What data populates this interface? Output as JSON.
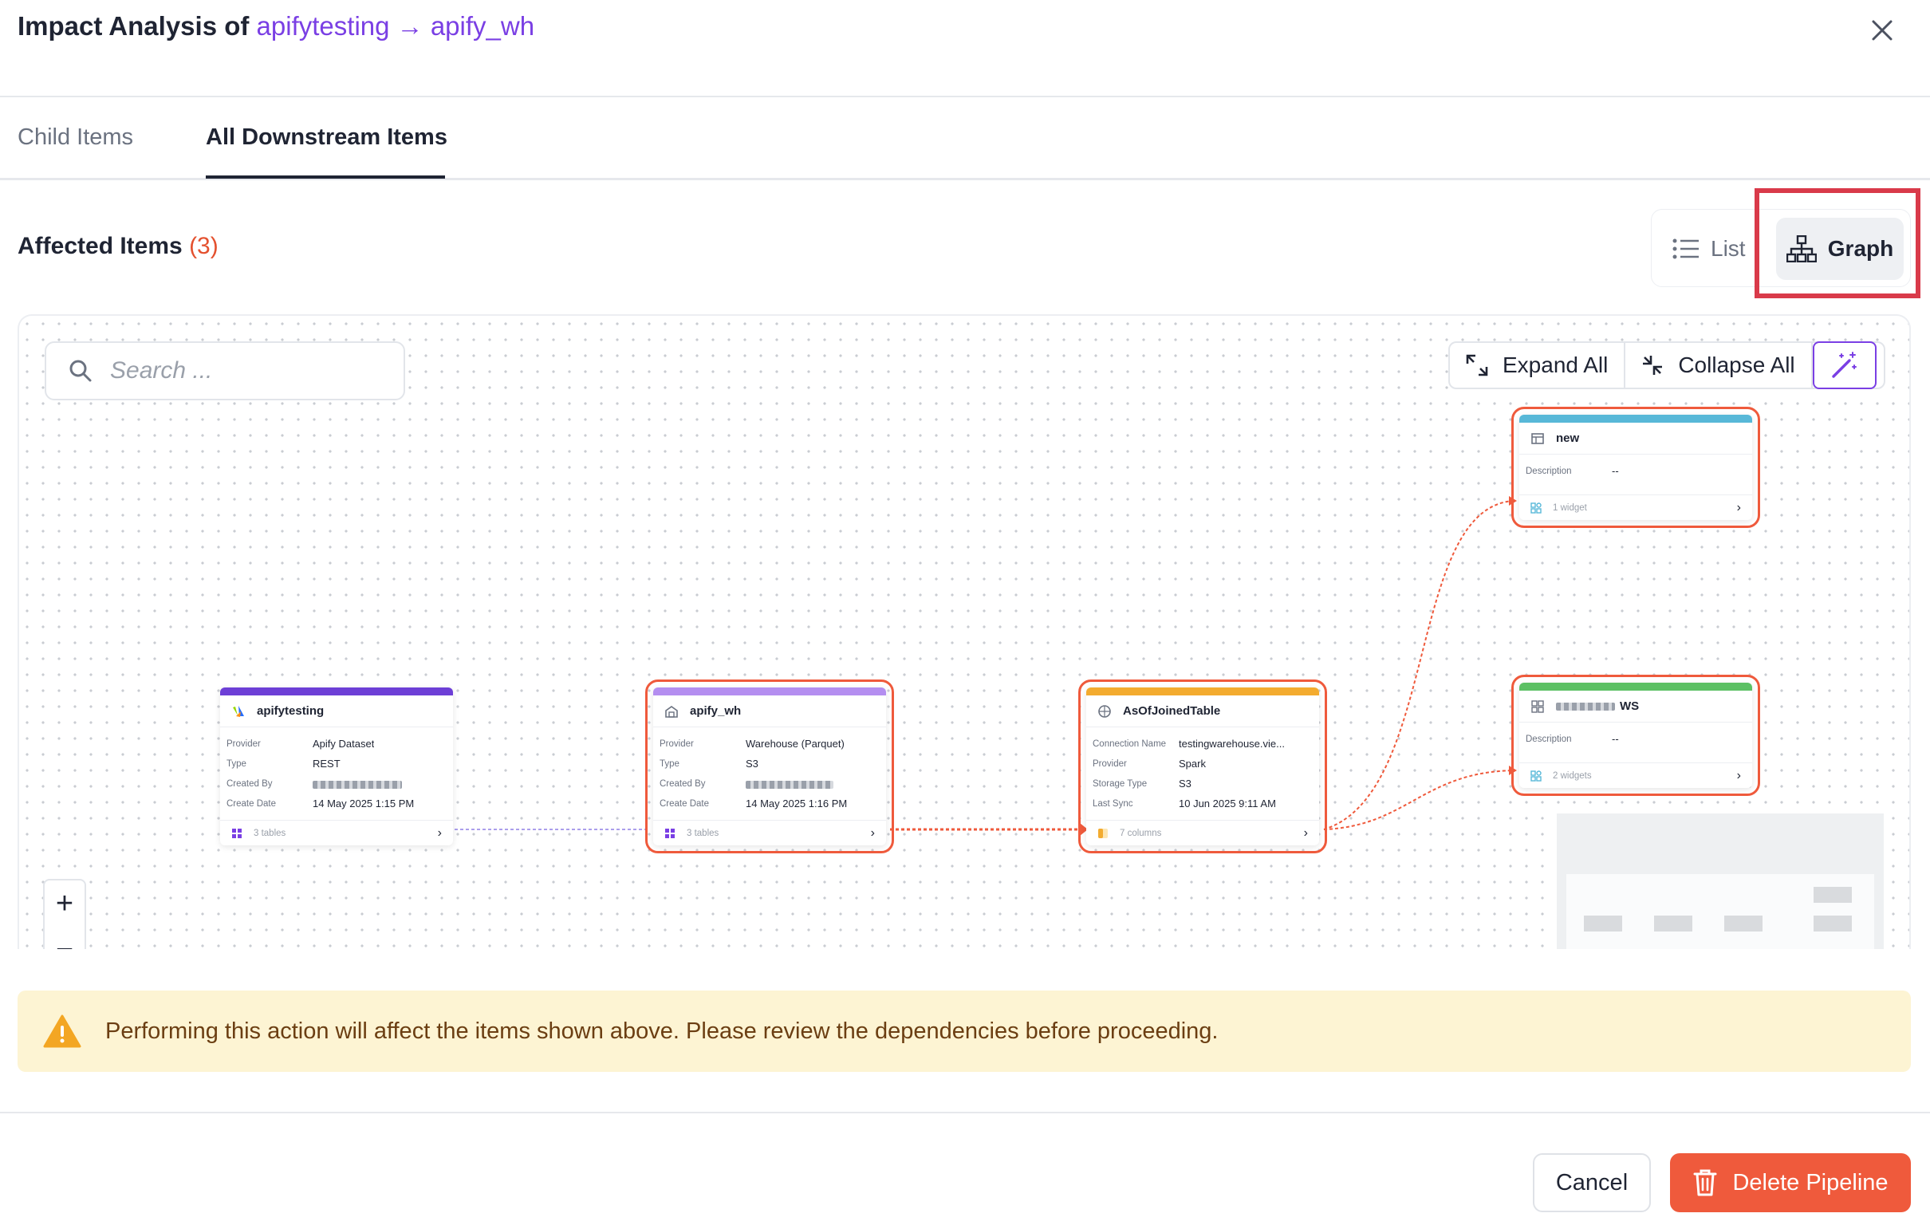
{
  "header": {
    "title_prefix": "Impact Analysis of",
    "title_source": "apifytesting",
    "title_arrow": "→",
    "title_target": "apify_wh"
  },
  "tabs": [
    {
      "label": "Child Items",
      "active": false
    },
    {
      "label": "All Downstream Items",
      "active": true
    }
  ],
  "affected": {
    "label": "Affected Items",
    "count": "(3)"
  },
  "view_toggle": {
    "list_label": "List",
    "graph_label": "Graph",
    "selected": "Graph"
  },
  "graph": {
    "search_placeholder": "Search ...",
    "expand_all": "Expand All",
    "collapse_all": "Collapse All",
    "nodes": {
      "apifytesting": {
        "title": "apifytesting",
        "rows": [
          {
            "k": "Provider",
            "v": "Apify Dataset"
          },
          {
            "k": "Type",
            "v": "REST"
          },
          {
            "k": "Created By",
            "v": ""
          },
          {
            "k": "Create Date",
            "v": "14 May 2025 1:15 PM"
          }
        ],
        "footer": "3 tables",
        "color": "#6d3fd6"
      },
      "apify_wh": {
        "title": "apify_wh",
        "rows": [
          {
            "k": "Provider",
            "v": "Warehouse (Parquet)"
          },
          {
            "k": "Type",
            "v": "S3"
          },
          {
            "k": "Created By",
            "v": ""
          },
          {
            "k": "Create Date",
            "v": "14 May 2025 1:16 PM"
          }
        ],
        "footer": "3 tables",
        "color": "#b48ef0"
      },
      "asof": {
        "title": "AsOfJoinedTable",
        "rows": [
          {
            "k": "Connection Name",
            "v": "testingwarehouse.vie..."
          },
          {
            "k": "Provider",
            "v": "Spark"
          },
          {
            "k": "Storage Type",
            "v": "S3"
          },
          {
            "k": "Last Sync",
            "v": "10 Jun 2025 9:11 AM"
          }
        ],
        "footer": "7 columns",
        "color": "#f3ab2f"
      },
      "new": {
        "title": "new",
        "rows": [
          {
            "k": "Description",
            "v": "--"
          }
        ],
        "footer": "1 widget",
        "color": "#58b8d8"
      },
      "ws": {
        "title": "WS",
        "rows": [
          {
            "k": "Description",
            "v": "--"
          }
        ],
        "footer": "2 widgets",
        "color": "#5cc064"
      }
    },
    "zoom_in": "+",
    "zoom_out": "−"
  },
  "warning": {
    "text": "Performing this action will affect the items shown above. Please review the dependencies before proceeding."
  },
  "footer": {
    "cancel_label": "Cancel",
    "delete_label": "Delete Pipeline"
  },
  "colors": {
    "accent": "#7a3fe4",
    "danger": "#ef5a3c",
    "highlight": "#d93a4a",
    "warning_bg": "#fdf4d3"
  }
}
